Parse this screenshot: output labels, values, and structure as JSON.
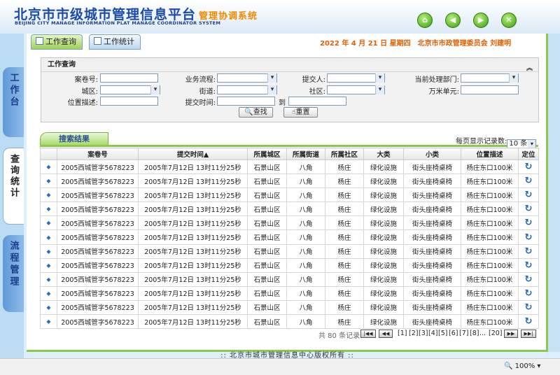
{
  "header": {
    "title": "北京市市级城市管理信息平台",
    "subtitle": "管理协调系统",
    "english": "BEIJING CITY MANAGE INFORMATION PLAT MANAGE COORDINATOR SYSTEM",
    "nav_icons": [
      "home-icon",
      "back-icon",
      "forward-icon",
      "close-icon"
    ]
  },
  "tabs": {
    "query": "工作查询",
    "stats": "工作统计"
  },
  "date_line": "2022 年 4 月 21 日 星期四　北京市市政管理委员会 刘建明",
  "sidebar": {
    "items": [
      "工作台",
      "查询统计",
      "流程管理"
    ]
  },
  "query": {
    "title": "工作查询",
    "labels": {
      "case_no": "案卷号:",
      "process": "业务流程:",
      "submitter": "提交人:",
      "dept": "当前处理部门:",
      "district": "城区:",
      "street": "街道:",
      "community": "社区:",
      "grid": "万米单元:",
      "location": "位置描述:",
      "submit_time": "提交时间:",
      "to": "到"
    },
    "buttons": {
      "search": "查找",
      "reset": "重置"
    }
  },
  "results": {
    "tab_label": "搜索结果",
    "per_page_label": "每页显示记录数:",
    "per_page_value": "10 条",
    "columns": [
      "",
      "案卷号",
      "提交时间▲",
      "所属城区",
      "所属街道",
      "所属社区",
      "大类",
      "小类",
      "位置描述",
      "定位"
    ],
    "rows": [
      [
        "2005西城管字5678223",
        "2005年7月12日 13时11分25秒",
        "石景山区",
        "八角",
        "杨庄",
        "绿化设施",
        "街头座椅桌椅",
        "杨庄东口100米"
      ],
      [
        "2005西城管字5678223",
        "2005年7月12日 13时11分25秒",
        "石景山区",
        "八角",
        "杨庄",
        "绿化设施",
        "街头座椅桌椅",
        "杨庄东口100米"
      ],
      [
        "2005西城管字5678223",
        "2005年7月12日 13时11分25秒",
        "石景山区",
        "八角",
        "杨庄",
        "绿化设施",
        "街头座椅桌椅",
        "杨庄东口100米"
      ],
      [
        "2005西城管字5678223",
        "2005年7月12日 13时11分25秒",
        "石景山区",
        "八角",
        "杨庄",
        "绿化设施",
        "街头座椅桌椅",
        "杨庄东口100米"
      ],
      [
        "2005西城管字5678223",
        "2005年7月12日 13时11分25秒",
        "石景山区",
        "八角",
        "杨庄",
        "绿化设施",
        "街头座椅桌椅",
        "杨庄东口100米"
      ],
      [
        "2005西城管字5678223",
        "2005年7月12日 13时11分25秒",
        "石景山区",
        "八角",
        "杨庄",
        "绿化设施",
        "街头座椅桌椅",
        "杨庄东口100米"
      ],
      [
        "2005西城管字5678223",
        "2005年7月12日 13时11分25秒",
        "石景山区",
        "八角",
        "杨庄",
        "绿化设施",
        "街头座椅桌椅",
        "杨庄东口100米"
      ],
      [
        "2005西城管字5678223",
        "2005年7月12日 13时11分25秒",
        "石景山区",
        "八角",
        "杨庄",
        "绿化设施",
        "街头座椅桌椅",
        "杨庄东口100米"
      ],
      [
        "2005西城管字5678223",
        "2005年7月12日 13时11分25秒",
        "石景山区",
        "八角",
        "杨庄",
        "绿化设施",
        "街头座椅桌椅",
        "杨庄东口100米"
      ],
      [
        "2005西城管字5678223",
        "2005年7月12日 13时11分25秒",
        "石景山区",
        "八角",
        "杨庄",
        "绿化设施",
        "街头座椅桌椅",
        "杨庄东口100米"
      ],
      [
        "2005西城管字5678223",
        "2005年7月12日 13时11分25秒",
        "石景山区",
        "八角",
        "杨庄",
        "绿化设施",
        "街头座椅桌椅",
        "杨庄东口100米"
      ],
      [
        "2005西城管字5678223",
        "2005年7月12日 13时11分25秒",
        "石景山区",
        "八角",
        "杨庄",
        "绿化设施",
        "街头座椅桌椅",
        "杨庄东口100米"
      ]
    ]
  },
  "pager": {
    "summary": "共 80 条记录",
    "pages": [
      "[1]",
      "[2]",
      "[3]",
      "[4]",
      "[5]",
      "[6]",
      "[7]",
      "[8]",
      "...",
      "[20]"
    ]
  },
  "footer": ":: 北京市城市管理信息中心版权所有 ::",
  "status": {
    "zoom": "100%"
  }
}
